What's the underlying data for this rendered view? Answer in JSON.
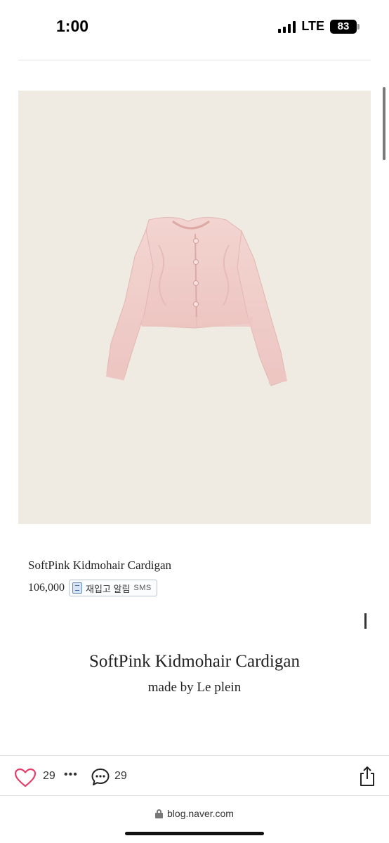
{
  "status_bar": {
    "time": "1:00",
    "network": "LTE",
    "battery": "83"
  },
  "product": {
    "image_icon": "pink-cardigan-photo",
    "name": "SoftPink Kidmohair Cardigan",
    "price": "106,000",
    "restock_label": "재입고 알림",
    "restock_sms": "SMS"
  },
  "post": {
    "title": "SoftPink Kidmohair Cardigan",
    "subtitle": "made by Le plein"
  },
  "bottom_bar": {
    "like_count": "29",
    "more_glyph": "•••",
    "comment_count": "29"
  },
  "browser": {
    "url": "blog.naver.com"
  },
  "colors": {
    "image_background": "#efebe2",
    "cardigan_pink": "#f0cdc9"
  }
}
